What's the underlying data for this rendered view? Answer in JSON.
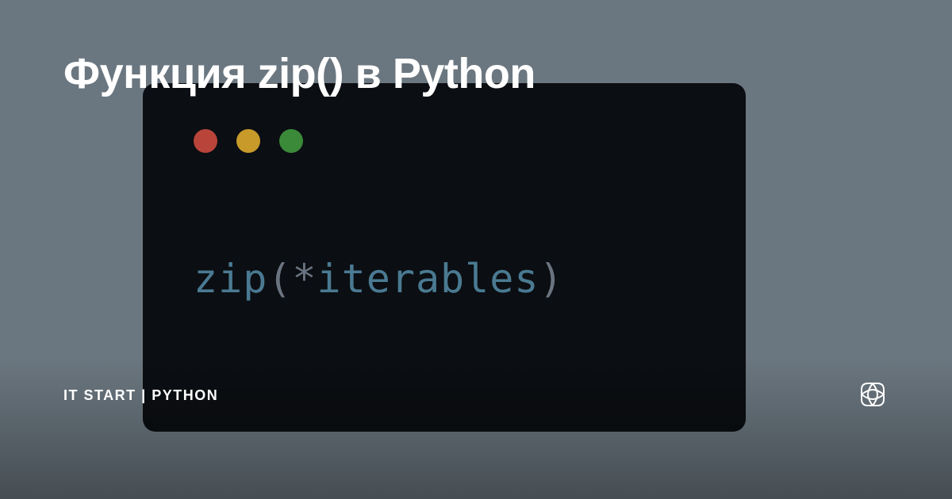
{
  "title": "Функция zip() в Python",
  "channel": "IT START | PYTHON",
  "code": {
    "fn": "zip",
    "open": "(",
    "star": "*",
    "arg": "iterables",
    "close": ")"
  },
  "dots": {
    "red": "#b8443a",
    "yellow": "#c79a2a",
    "green": "#3a8a3a"
  }
}
